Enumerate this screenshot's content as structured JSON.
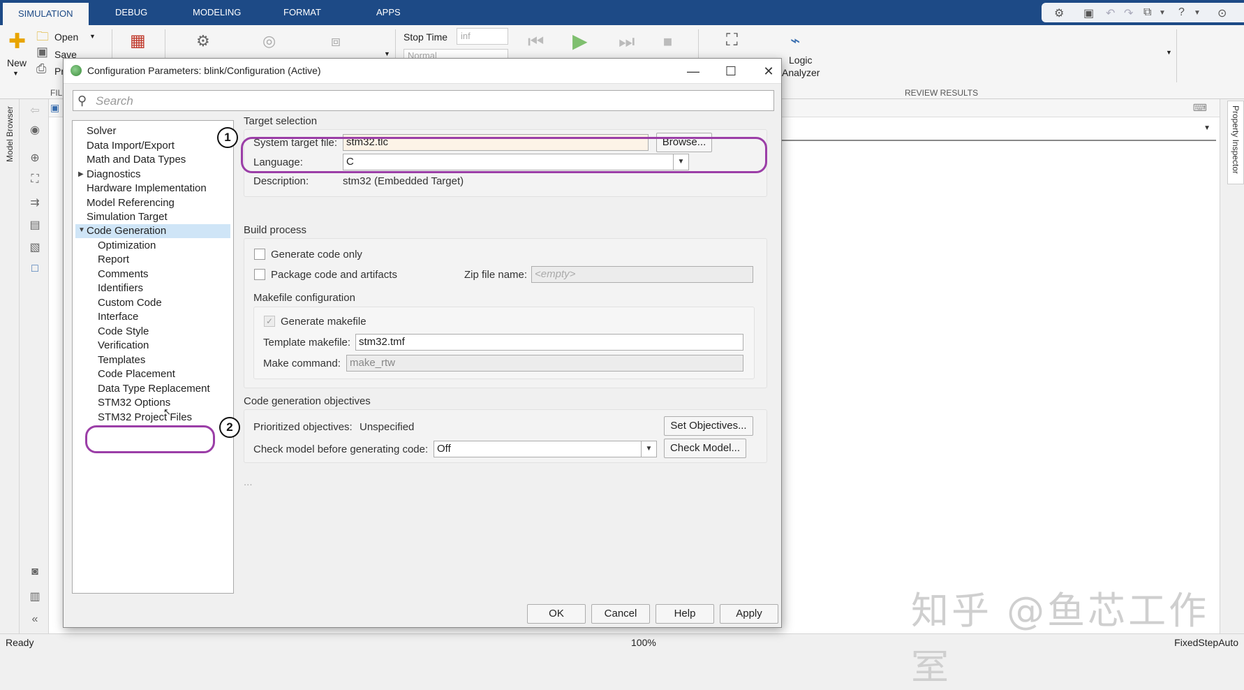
{
  "tabs": [
    "SIMULATION",
    "DEBUG",
    "MODELING",
    "FORMAT",
    "APPS"
  ],
  "ribbon": {
    "new_label": "New",
    "open_label": "Open",
    "save_label": "Save",
    "print_label": "Pr",
    "file_section": "FILE",
    "stop_time_label": "Stop Time",
    "stop_time_value": "inf",
    "sim_mode_value": "Normal",
    "logic_analyzer_line1": "Logic",
    "logic_analyzer_line2": "Analyzer",
    "review_section": "REVIEW RESULTS"
  },
  "side_labels": {
    "model_browser": "Model Browser",
    "property_inspector": "Property Inspector"
  },
  "dialog": {
    "title": "Configuration Parameters: blink/Configuration (Active)",
    "search_placeholder": "Search",
    "tree": [
      "Solver",
      "Data Import/Export",
      "Math and Data Types",
      "Diagnostics",
      "Hardware Implementation",
      "Model Referencing",
      "Simulation Target",
      "Code Generation",
      "Optimization",
      "Report",
      "Comments",
      "Identifiers",
      "Custom Code",
      "Interface",
      "Code Style",
      "Verification",
      "Templates",
      "Code Placement",
      "Data Type Replacement",
      "STM32 Options",
      "STM32 Project Files"
    ],
    "target": {
      "section": "Target selection",
      "system_target_label": "System target file:",
      "system_target_value": "stm32.tlc",
      "browse_label": "Browse...",
      "language_label": "Language:",
      "language_value": "C",
      "description_label": "Description:",
      "description_value": "stm32 (Embedded Target)"
    },
    "build": {
      "section": "Build process",
      "generate_code_only": "Generate code only",
      "package_code": "Package code and artifacts",
      "zip_label": "Zip file name:",
      "zip_placeholder": "<empty>",
      "makefile_section": "Makefile configuration",
      "generate_makefile": "Generate makefile",
      "template_label": "Template makefile:",
      "template_value": "stm32.tmf",
      "make_command_label": "Make command:",
      "make_command_value": "make_rtw"
    },
    "objectives": {
      "section": "Code generation objectives",
      "prioritized_label": "Prioritized objectives:",
      "prioritized_value": "Unspecified",
      "set_objectives_label": "Set Objectives...",
      "check_model_label": "Check model before generating code:",
      "check_model_value": "Off",
      "check_model_button": "Check Model..."
    },
    "ellipsis": "...",
    "buttons": {
      "ok": "OK",
      "cancel": "Cancel",
      "help": "Help",
      "apply": "Apply"
    }
  },
  "annotations": {
    "marker1": "1",
    "marker2": "2"
  },
  "status": {
    "left": "Ready",
    "center": "100%",
    "right": "FixedStepAuto"
  },
  "watermark": "知乎 @鱼芯工作室",
  "colors": {
    "tabbar": "#1d4a86",
    "highlight": "#9b3ea7",
    "selection": "#cfe5f7"
  }
}
